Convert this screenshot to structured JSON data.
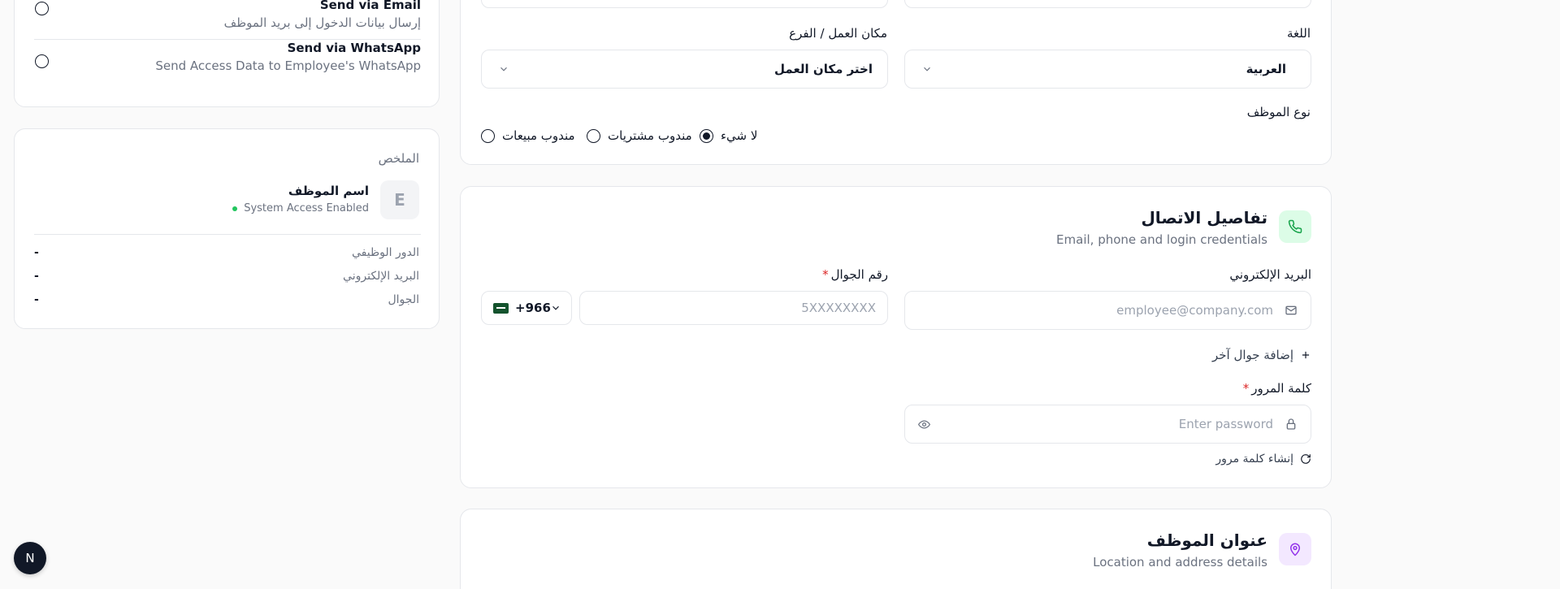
{
  "colors": {
    "phone_icon_bg": "#dcfce7",
    "phone_icon": "#16a34a",
    "location_icon_bg": "#f3e8ff",
    "location_icon": "#9333ea",
    "status_dot": "#22c55e",
    "required": "#dc2626"
  },
  "left": {
    "send_email": {
      "title": "Send via Email",
      "desc": "إرسال بيانات الدخول إلى بريد الموظف"
    },
    "send_whatsapp": {
      "title": "Send via WhatsApp",
      "desc": "Send Access Data to Employee's WhatsApp"
    },
    "summary": {
      "heading": "الملخص",
      "avatar_letter": "E",
      "employee_name": "اسم الموظف",
      "status": "System Access Enabled",
      "rows": [
        {
          "label": "الدور الوظيفي",
          "value": "-"
        },
        {
          "label": "البريد الإلكتروني",
          "value": "-"
        },
        {
          "label": "الجوال",
          "value": "-"
        }
      ]
    },
    "floating_avatar_letter": "N"
  },
  "form": {
    "language_label": "اللغة",
    "language_value": "العربية",
    "workplace_label": "مكان العمل / الفرع",
    "workplace_placeholder": "اختر مكان العمل",
    "employee_type_label": "نوع الموظف",
    "employee_types": [
      "لا شيء",
      "مندوب مشتريات",
      "مندوب مبيعات"
    ]
  },
  "contact": {
    "title": "تفاصيل الاتصال",
    "subtitle": "Email, phone and login credentials",
    "email_label": "البريد الإلكتروني",
    "email_placeholder": "employee@company.com",
    "phone_label": "رقم الجوال",
    "phone_placeholder": "5XXXXXXXX",
    "country_code": "+966",
    "add_phone": "إضافة جوال آخر",
    "password_label": "كلمة المرور",
    "password_placeholder": "Enter password",
    "generate_password": "إنشاء كلمة مرور"
  },
  "address": {
    "title": "عنوان الموظف",
    "subtitle": "Location and address details"
  }
}
